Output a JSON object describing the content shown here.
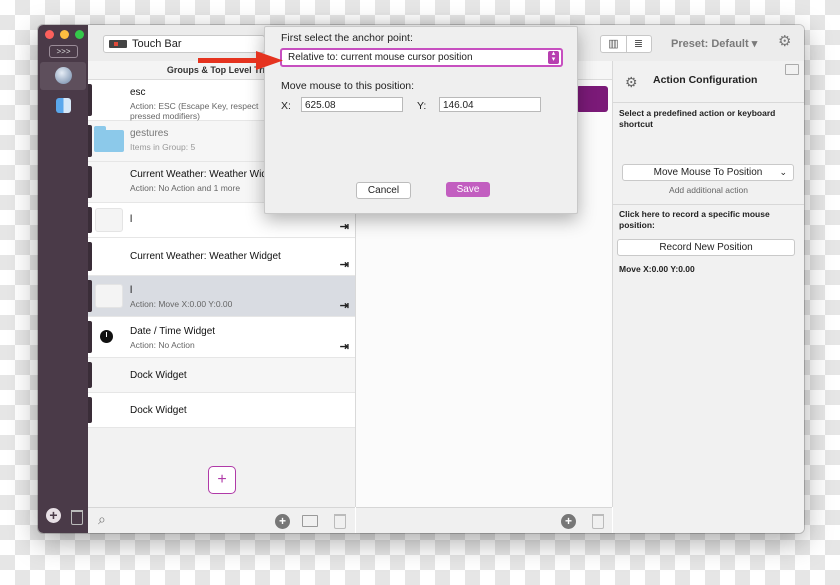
{
  "toolbar": {
    "touchbar_select": "Touch Bar",
    "preset_label": "Preset: Default",
    "preset_arrow": "▾"
  },
  "groups": {
    "header": "Groups & Top Level Trigg",
    "rows": [
      {
        "title": "esc",
        "line1": "Action: ESC (Escape Key, respect",
        "line2": "pressed modifiers)"
      },
      {
        "title": "gestures",
        "line1": "Items in Group: 5"
      },
      {
        "title": "Current Weather: Weather Wid",
        "line1": "Action: No Action and 1 more"
      },
      {
        "title": "l"
      },
      {
        "title": "Current Weather: Weather Widget"
      },
      {
        "title": "l",
        "line1": "Action: Move X:0.00 Y:0.00"
      },
      {
        "title": "Date / Time Widget",
        "line1": "Action: No Action"
      },
      {
        "title": "Dock Widget"
      },
      {
        "title": "Dock Widget"
      }
    ],
    "add_button": "+"
  },
  "dialog": {
    "anchor_label": "First select the anchor point:",
    "anchor_value": "Relative to: current mouse cursor position",
    "move_label": "Move mouse to this position:",
    "x_label": "X:",
    "x_value": "625.08",
    "y_label": "Y:",
    "y_value": "146.04",
    "cancel": "Cancel",
    "save": "Save"
  },
  "config": {
    "title": "Action Configuration",
    "predefined_label": "Select a predefined action or keyboard shortcut",
    "action_value": "Move Mouse To Position",
    "add_action": "Add additional action",
    "record_label": "Click here to record a specific mouse position:",
    "record_button": "Record New Position",
    "move_readout": "Move X:0.00 Y:0.00"
  },
  "strip": {
    "expand": ">>>"
  },
  "colors": {
    "accent": "#c25ec0",
    "strip": "#4a3a48",
    "arrow": "#e5331f",
    "purple_bar": "#7b1a78"
  }
}
